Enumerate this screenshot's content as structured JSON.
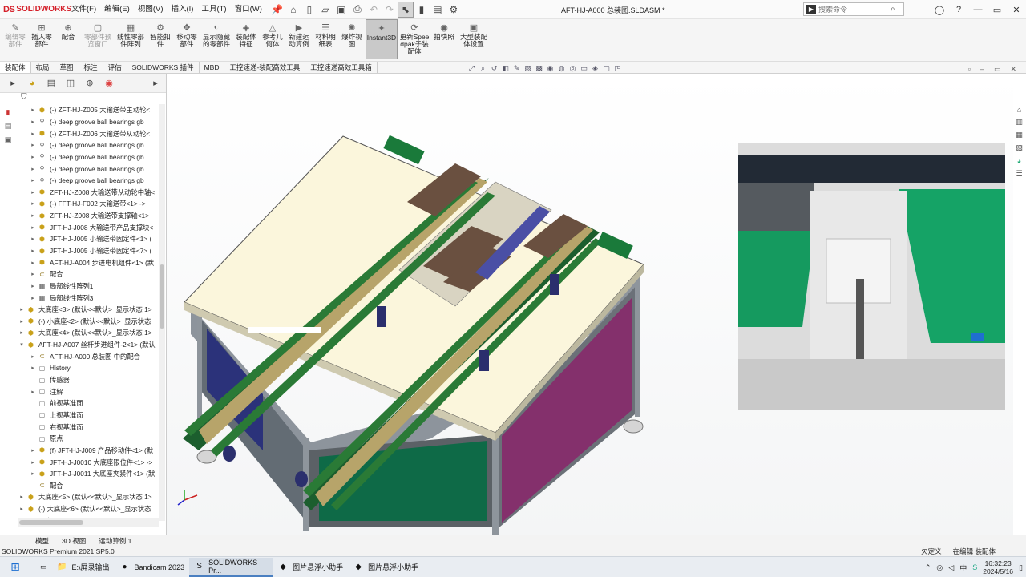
{
  "app": {
    "brand_ds": "DS",
    "brand_name": "SOLIDWORKS",
    "doc_title": "AFT-HJ-A000 总装图.SLDASM *"
  },
  "menu": [
    "文件(F)",
    "编辑(E)",
    "视图(V)",
    "插入(I)",
    "工具(T)",
    "窗口(W)"
  ],
  "quick_access_icons": [
    "home-icon",
    "new-icon",
    "open-icon",
    "save-icon",
    "print-icon",
    "undo-icon",
    "redo-icon",
    "select-icon",
    "rebuild-icon",
    "file-properties-icon",
    "options-icon"
  ],
  "search": {
    "lead": "▶",
    "placeholder": "搜索命令"
  },
  "ribbon": [
    {
      "label": "编辑零部件",
      "icon": "✎",
      "dim": true
    },
    {
      "label": "插入零部件",
      "icon": "⊞",
      "dim": false
    },
    {
      "label": "配合",
      "icon": "⊕",
      "dim": false
    },
    {
      "label": "零部件预览窗口",
      "icon": "▢",
      "dim": true
    },
    {
      "label": "线性零部件阵列",
      "icon": "▦",
      "dim": false
    },
    {
      "label": "智能扣件",
      "icon": "⚙",
      "dim": false
    },
    {
      "label": "移动零部件",
      "icon": "✥",
      "dim": false
    },
    {
      "label": "显示隐藏的零部件",
      "icon": "◐",
      "dim": false
    },
    {
      "label": "装配体特征",
      "icon": "◈",
      "dim": false
    },
    {
      "label": "参考几何体",
      "icon": "△",
      "dim": false
    },
    {
      "label": "新建运动算例",
      "icon": "▶",
      "dim": false
    },
    {
      "label": "材料明细表",
      "icon": "☰",
      "dim": false
    },
    {
      "label": "爆炸视图",
      "icon": "✺",
      "dim": false
    },
    {
      "label": "Instant3D",
      "icon": "✦",
      "dim": false,
      "active": true
    },
    {
      "label": "更新Speedpak子装配体",
      "icon": "⟳",
      "dim": false
    },
    {
      "label": "拍快照",
      "icon": "◉",
      "dim": false
    },
    {
      "label": "大型装配体设置",
      "icon": "▣",
      "dim": false
    }
  ],
  "cmd_tabs": [
    "装配体",
    "布局",
    "草图",
    "标注",
    "评估",
    "SOLIDWORKS 插件",
    "MBD",
    "工控速递-装配高效工具",
    "工控速递高效工具箱"
  ],
  "fm_tabs": [
    "feature-manager-icon",
    "property-manager-icon",
    "configuration-manager-icon",
    "dimxpert-icon",
    "display-manager-icon"
  ],
  "tree": [
    {
      "indent": 1,
      "exp": "▸",
      "icon": "asm",
      "label": "(-) ZFT-HJ-Z005 大输送带主动轮<"
    },
    {
      "indent": 1,
      "exp": "▸",
      "icon": "bolt",
      "label": "(-) deep groove ball bearings gb"
    },
    {
      "indent": 1,
      "exp": "▸",
      "icon": "asm",
      "label": "(-) ZFT-HJ-Z006 大输送带从动轮<"
    },
    {
      "indent": 1,
      "exp": "▸",
      "icon": "bolt",
      "label": "(-) deep groove ball bearings gb"
    },
    {
      "indent": 1,
      "exp": "▸",
      "icon": "bolt",
      "label": "(-) deep groove ball bearings gb"
    },
    {
      "indent": 1,
      "exp": "▸",
      "icon": "bolt",
      "label": "(-) deep groove ball bearings gb"
    },
    {
      "indent": 1,
      "exp": "▸",
      "icon": "bolt",
      "label": "(-) deep groove ball bearings gb"
    },
    {
      "indent": 1,
      "exp": "▸",
      "icon": "asm",
      "label": "ZFT-HJ-Z008 大输送带从动轮中轴<"
    },
    {
      "indent": 1,
      "exp": "▸",
      "icon": "asm",
      "label": "(-) FFT-HJ-F002  大输送带<1> ->"
    },
    {
      "indent": 1,
      "exp": "▸",
      "icon": "asm",
      "label": "ZFT-HJ-Z008 大输送带支撑轴<1>"
    },
    {
      "indent": 1,
      "exp": "▸",
      "icon": "asm",
      "label": "JFT-HJ-J008 大输送带产品支撑块<"
    },
    {
      "indent": 1,
      "exp": "▸",
      "icon": "asm",
      "label": "JFT-HJ-J005 小输送带固定件<1> ("
    },
    {
      "indent": 1,
      "exp": "▸",
      "icon": "asm",
      "label": "JFT-HJ-J005 小输送带固定件<7> ("
    },
    {
      "indent": 1,
      "exp": "▸",
      "icon": "asm",
      "label": "AFT-HJ-A004 步进电机组件<1> (默"
    },
    {
      "indent": 1,
      "exp": "▸",
      "icon": "mate",
      "label": "配合"
    },
    {
      "indent": 1,
      "exp": "▸",
      "icon": "pat",
      "label": "局部线性阵列1"
    },
    {
      "indent": 1,
      "exp": "▸",
      "icon": "pat",
      "label": "局部线性阵列3"
    },
    {
      "indent": 0,
      "exp": "▸",
      "icon": "asm",
      "label": "大底座<3> (默认<<默认>_显示状态 1>"
    },
    {
      "indent": 0,
      "exp": "▸",
      "icon": "asm",
      "label": "(-) 小底座<2> (默认<<默认>_显示状态"
    },
    {
      "indent": 0,
      "exp": "▸",
      "icon": "asm",
      "label": "大底座<4> (默认<<默认>_显示状态 1>"
    },
    {
      "indent": 0,
      "exp": "▾",
      "icon": "asm",
      "label": "AFT-HJ-A007 丝杆步进组件-2<1> (默认"
    },
    {
      "indent": 1,
      "exp": "▸",
      "icon": "mate",
      "label": "AFT-HJ-A000 总装图 中的配合"
    },
    {
      "indent": 1,
      "exp": "▸",
      "icon": "gen",
      "label": "History"
    },
    {
      "indent": 1,
      "exp": "",
      "icon": "gen",
      "label": "传感器"
    },
    {
      "indent": 1,
      "exp": "▸",
      "icon": "gen",
      "label": "注解"
    },
    {
      "indent": 1,
      "exp": "",
      "icon": "gen",
      "label": "前视基准面"
    },
    {
      "indent": 1,
      "exp": "",
      "icon": "gen",
      "label": "上视基准面"
    },
    {
      "indent": 1,
      "exp": "",
      "icon": "gen",
      "label": "右视基准面"
    },
    {
      "indent": 1,
      "exp": "",
      "icon": "gen",
      "label": "原点"
    },
    {
      "indent": 1,
      "exp": "▸",
      "icon": "asm",
      "label": "(f) JFT-HJ-J009 产品移动件<1> (默"
    },
    {
      "indent": 1,
      "exp": "▸",
      "icon": "asm",
      "label": "JFT-HJ-J0010 大底座限位件<1> ->"
    },
    {
      "indent": 1,
      "exp": "▸",
      "icon": "asm",
      "label": "JFT-HJ-J0011 大底座夹紧件<1> (默"
    },
    {
      "indent": 1,
      "exp": "",
      "icon": "mate",
      "label": "配合"
    },
    {
      "indent": 0,
      "exp": "▸",
      "icon": "asm",
      "label": "大底座<5> (默认<<默认>_显示状态 1>"
    },
    {
      "indent": 0,
      "exp": "▸",
      "icon": "asm",
      "label": "(-) 大底座<6> (默认<<默认>_显示状态"
    },
    {
      "indent": 0,
      "exp": "▸",
      "icon": "mate",
      "label": "配合"
    }
  ],
  "bottom_tabs": [
    "模型",
    "3D 视图",
    "运动算例 1"
  ],
  "status": {
    "left": "SOLIDWORKS Premium 2021 SP5.0",
    "right": [
      "欠定义",
      "在编辑 装配体"
    ]
  },
  "taskbar": {
    "items": [
      {
        "icon": "📁",
        "label": "E:\\屏录输出",
        "on": false
      },
      {
        "icon": "●",
        "label": "Bandicam 2023",
        "on": false
      },
      {
        "icon": "S",
        "label": "SOLIDWORKS Pr...",
        "on": true
      },
      {
        "icon": "◆",
        "label": "图片悬浮小助手",
        "on": false
      },
      {
        "icon": "◆",
        "label": "图片悬浮小助手",
        "on": false
      }
    ],
    "ime": "中",
    "time": "16:32:23",
    "date": "2024/5/16"
  }
}
